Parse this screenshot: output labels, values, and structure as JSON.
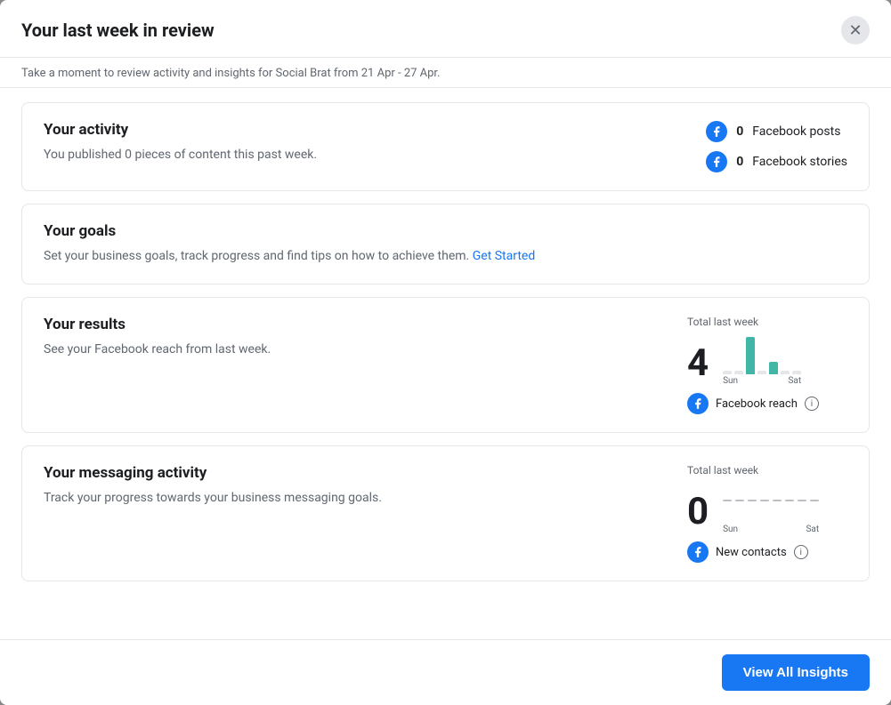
{
  "modal": {
    "title": "Your last week in review",
    "close_label": "×",
    "subtitle": "Take a moment to review activity and insights for Social Brat from 21 Apr - 27 Apr.",
    "footer": {
      "view_insights_label": "View All Insights"
    }
  },
  "activity_card": {
    "title": "Your activity",
    "description": "You published 0 pieces of content this past week.",
    "items": [
      {
        "count": "0",
        "label": "Facebook posts"
      },
      {
        "count": "0",
        "label": "Facebook stories"
      }
    ]
  },
  "goals_card": {
    "title": "Your goals",
    "description": "Set your business goals, track progress and find tips on how to achieve them.",
    "link_text": "Get Started"
  },
  "results_card": {
    "title": "Your results",
    "description": "See your Facebook reach from last week.",
    "total_label": "Total last week",
    "total_number": "4",
    "chart_sun_label": "Sun",
    "chart_sat_label": "Sat",
    "metric_label": "Facebook reach",
    "bars": [
      {
        "height": 0,
        "type": "empty"
      },
      {
        "height": 0,
        "type": "empty"
      },
      {
        "height": 42,
        "type": "teal"
      },
      {
        "height": 0,
        "type": "empty"
      },
      {
        "height": 14,
        "type": "teal"
      },
      {
        "height": 0,
        "type": "empty"
      },
      {
        "height": 0,
        "type": "empty"
      }
    ]
  },
  "messaging_card": {
    "title": "Your messaging activity",
    "description": "Track your progress towards your business messaging goals.",
    "total_label": "Total last week",
    "total_number": "0",
    "chart_sun_label": "Sun",
    "chart_sat_label": "Sat",
    "metric_label": "New contacts"
  },
  "icons": {
    "close": "✕",
    "info": "i"
  }
}
